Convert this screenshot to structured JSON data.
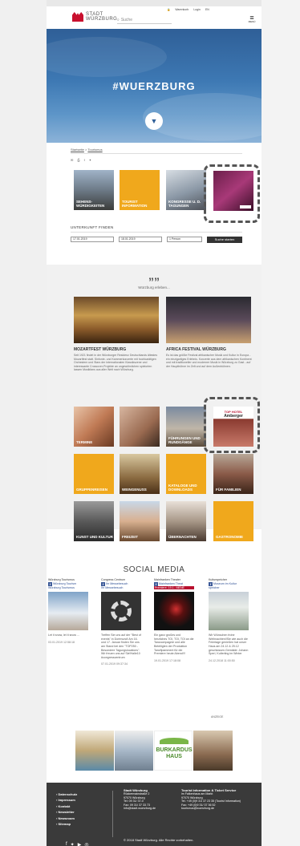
{
  "header": {
    "logo_line1": "STADT",
    "logo_line2": "WÜRZBURG",
    "search_placeholder": "Suche",
    "nav": [
      "Warenkorb",
      "Login",
      "EN"
    ],
    "menu_label": "MENÜ"
  },
  "hero": {
    "title": "#WUERZBURG"
  },
  "breadcrumb": [
    "Startseite",
    "Tourismus"
  ],
  "top_tiles": [
    {
      "label": "SEHENS-\nWÜRDIGKEITEN"
    },
    {
      "label": "TOURIST\nINFORMATION"
    },
    {
      "label": "KONGRESSE U. D.\nTAGUNGEN"
    },
    {
      "label": ""
    }
  ],
  "finder": {
    "title": "UNTERKUNFT FINDEN",
    "arrival": "17.01.2019",
    "departure": "18.01.2019",
    "persons": "1 Person",
    "button": "Suche starten"
  },
  "quote": {
    "mark": "””",
    "subtitle": "Würzburg erleben..."
  },
  "events": [
    {
      "title": "MOZARTFEST WÜRZBURG",
      "text": "Seit 1921 findet in der Würzburger Residenz Deutschlands ältestes Mozartfest statt. Sinfonie- und Kammerkonzerte mit hochkarätigen Orchestern und Stars der internationalen Klassikszene und interessante Crossover-Projekte an ungewöhnlichen spielorten lassen Musikfans aus aller Welt nach Würzburg."
    },
    {
      "title": "AFRICA FESTIVAL WÜRZBURG",
      "text": "Es ist das größte Festival afrikanischer Musik und Kultur in Europa - ein einzigartiges Erlebnis. Konzerte aus dem afrikanischen Kontinent und mit traditioneller und moderner Musik in Würzburg zu Gast - auf der Hauptbühne im Zelt und auf dem Außenbühnen."
    }
  ],
  "grid_tiles": [
    "TERMINE",
    "",
    "FÜHRUNGEN UND RUNDGÄNGE",
    "",
    "GRUPPENREISEN",
    "WEINGENUSS",
    "KATALOGE UND DOWNLOADS",
    "FÜR FAMILIEN",
    "KUNST UND KULTUR",
    "FREIZEIT",
    "ÜBERNACHTEN",
    "GASTRONOMIE"
  ],
  "top_hotel": {
    "line1": "TOP HOTEL",
    "line2": "Amberger"
  },
  "social": {
    "title": "SOCIAL MEDIA",
    "feeds": [
      {
        "source": "Würzburg Tourismus",
        "page": "Würzburg Tourism",
        "sub": "Würzburg Tourismus",
        "msg": "Let it snow, let it snow ...",
        "date": "03.01.2019 12:58:18"
      },
      {
        "source": "Congress Centrum",
        "page": "Ihr Messebesuch",
        "sub": "Ihr Messebesuch",
        "msg": "Treffen Sie uns auf der \"Best of events\" in Dortmund! Am 16. und 17. Januar finden Sie uns am Stand bei den \"TOP250 - Besondere Tagungslocations\". Wir freuen uns auf Sie!Halle10 #congresscentrum",
        "date": "07.01.2019 09:37:34"
      },
      {
        "source": "Mainfranken Theater",
        "page": "Mainfranken Theat",
        "sub": "Premiere: 19.1.: MENE",
        "msg": "Ein ganz großes und herzliches TOI, TOI, TOI an die Tanzcompagnie und alle Beteiligten der Produktion Tanzfipamment für die Premiere heute Abend!!!",
        "date": "19.01.2019 17:18:08"
      },
      {
        "source": "Kulturspeicher",
        "page": "Museum im Kultur",
        "sub": "speicher",
        "msg": "Wir Wünschen frohe Weihnachtenl!Sie wie auch die Feiertage genießen hat unser Haus am 24.12 & 25.12 geschlossen.Gemälde: Johann Sperl, Kulterling im Winter",
        "date": "24.12.2018 11:00:50"
      }
    ],
    "more": "ANZEIGE"
  },
  "partners": {
    "burkardus1": "BURKARDUS",
    "burkardus2": "HAUS"
  },
  "footer": {
    "links": [
      "Datenschutz",
      "Impressum",
      "Kontakt",
      "Newsletter",
      "Newsroom",
      "Sitemap"
    ],
    "col1_title": "Stadt Würzburg",
    "col1": [
      "Rückermainstraße 2",
      "97070 Würzburg",
      "Tel: 09 31/ 37-0",
      "Fax: 09 31/ 37 33 73",
      "info@stadt.wuerzburg.de"
    ],
    "col2_title": "Tourist Information & Ticket Service",
    "col2": [
      "im Falkenhaus am Markt",
      "97070 Würzburg",
      "Tel. +49 (0)9 31/ 37 23 35 (Tourist Information)",
      "Fax: +49 (0)9 31/ 37 36 52",
      "tourismus@wuerzburg.de"
    ],
    "copyright": "© 2018 Stadt Würzburg. Alle Rechte vorbehalten."
  },
  "colors": {
    "accent": "#f0a81c",
    "hero": "#3d78b3",
    "brand_red": "#c8102e",
    "footer": "#3a3a3a",
    "facebook": "#3b5998"
  }
}
